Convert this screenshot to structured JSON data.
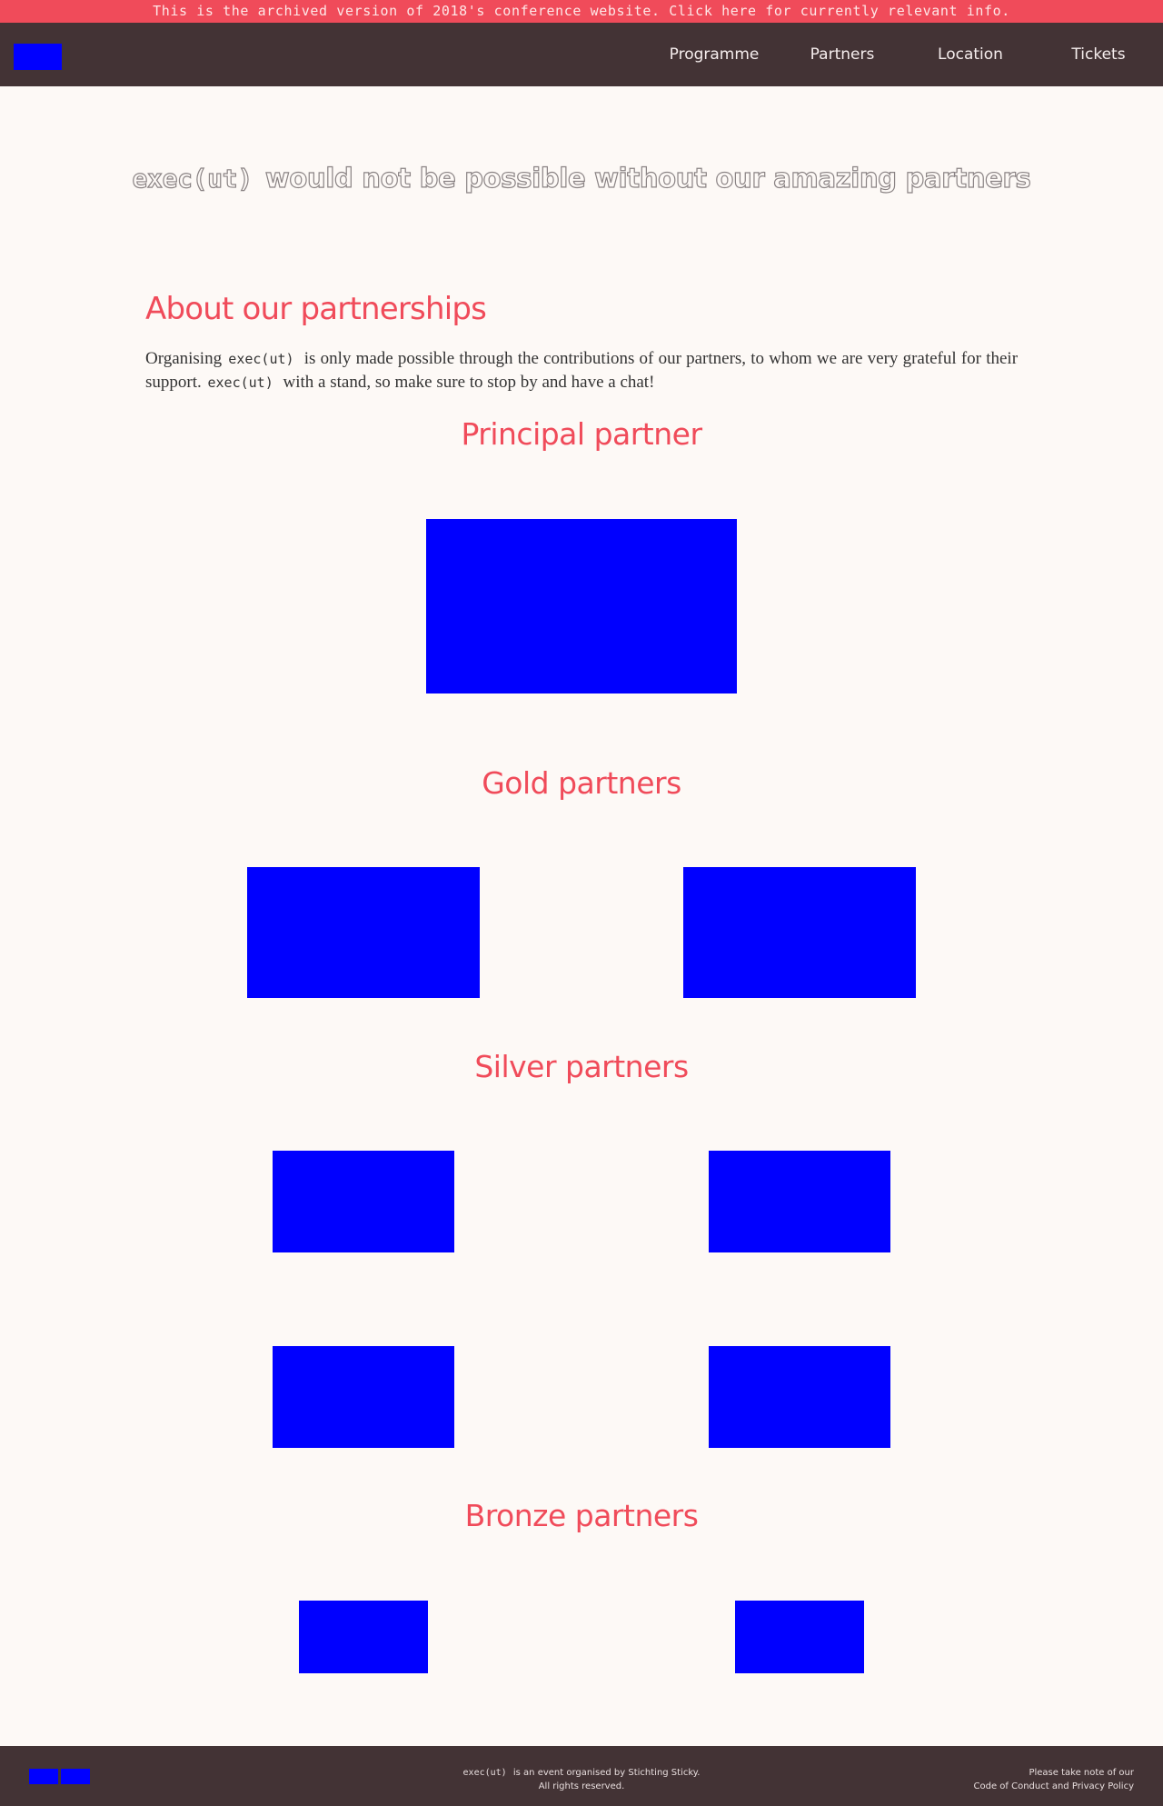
{
  "banner": {
    "text": "This is the archived version of 2018's conference website. Click here for currently relevant info."
  },
  "nav": {
    "links": [
      {
        "label": "Programme"
      },
      {
        "label": "Partners"
      },
      {
        "label": "Location"
      },
      {
        "label": "Tickets"
      }
    ]
  },
  "hero": {
    "brand": "exec(ut)",
    "title": "would not be possible without our amazing partners"
  },
  "about": {
    "heading": "About our partnerships",
    "text_part1": "Organising",
    "brand": "exec(ut)",
    "text_part2": "is only made possible through the contributions of our partners, to whom we are very grateful for their support.",
    "brand2": "exec(ut)",
    "text_part3": "with a stand, so make sure to stop by and have a chat!"
  },
  "tiers": {
    "principal": {
      "heading": "Principal partner"
    },
    "gold": {
      "heading": "Gold partners"
    },
    "silver": {
      "heading": "Silver partners"
    },
    "bronze": {
      "heading": "Bronze partners"
    }
  },
  "footer": {
    "brand": "exec(ut)",
    "organised_text": "is an event organised by",
    "organiser": "Stichting Sticky",
    "organiser_suffix": ".",
    "rights": "All rights reserved.",
    "note": "Please take note of our",
    "coc_link": "Code of Conduct",
    "and": "and",
    "privacy_link": "Privacy Policy"
  },
  "colors": {
    "accent": "#f04b5a",
    "nav_background": "#433335",
    "page_background": "#fdf9f6",
    "logo_placeholder": "#0000ff"
  }
}
